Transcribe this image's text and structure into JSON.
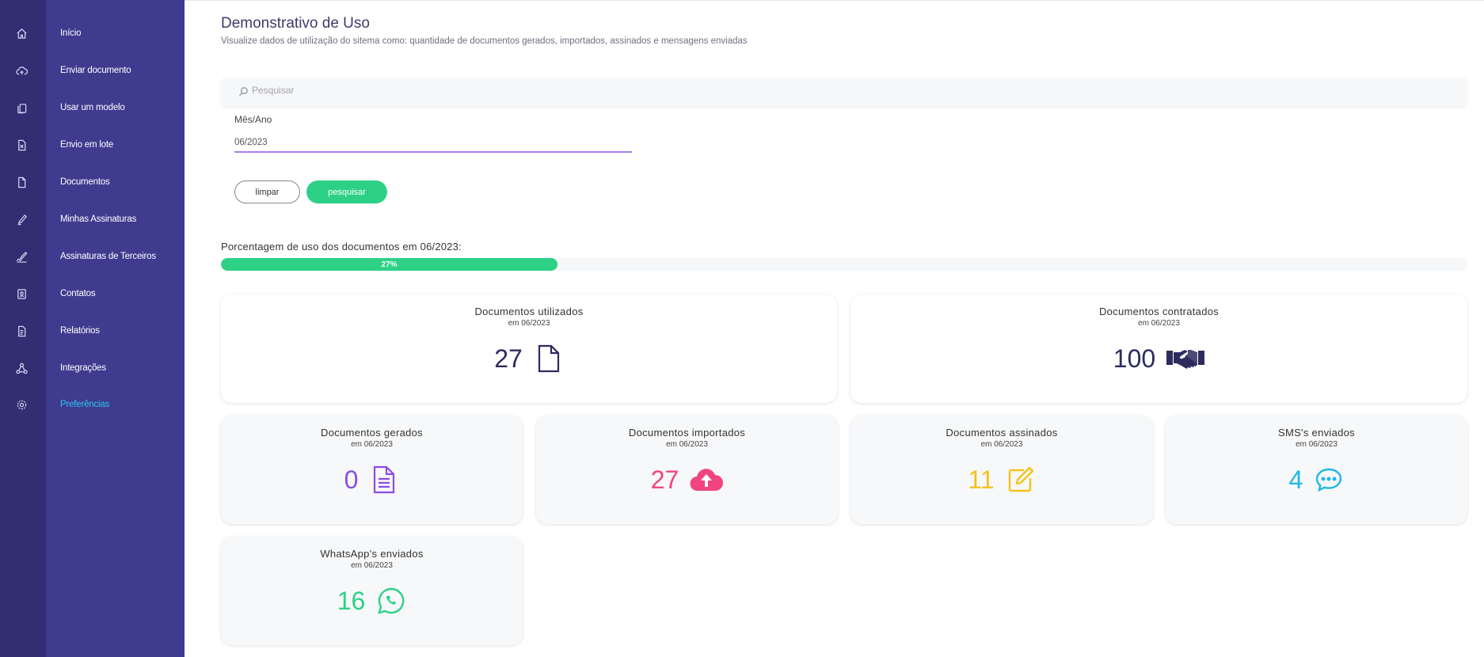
{
  "sidebar": {
    "items": [
      {
        "label": "Início",
        "icon": "home-icon"
      },
      {
        "label": "Enviar documento",
        "icon": "cloud-upload-icon"
      },
      {
        "label": "Usar um modelo",
        "icon": "template-icon"
      },
      {
        "label": "Envio em lote",
        "icon": "spreadsheet-icon"
      },
      {
        "label": "Documentos",
        "icon": "document-icon"
      },
      {
        "label": "Minhas Assinaturas",
        "icon": "pen-icon"
      },
      {
        "label": "Assinaturas de Terceiros",
        "icon": "signature-icon"
      },
      {
        "label": "Contatos",
        "icon": "contacts-icon"
      },
      {
        "label": "Relatórios",
        "icon": "report-icon"
      },
      {
        "label": "Integrações",
        "icon": "integrations-icon"
      },
      {
        "label": "Preferências",
        "icon": "gear-icon",
        "active": true
      }
    ]
  },
  "header": {
    "title": "Demonstrativo de Uso",
    "subtitle": "Visualize dados de utilização do sitema como: quantidade de documentos gerados, importados, assinados e mensagens enviadas"
  },
  "search": {
    "placeholder": "Pesquisar"
  },
  "filter": {
    "label": "Mês/Ano",
    "value": "06/2023",
    "clear_label": "limpar",
    "search_label": "pesquisar"
  },
  "usage": {
    "label": "Porcentagem de uso dos documentos em 06/2023:",
    "percent": 27,
    "percent_label": "27%"
  },
  "cards": {
    "utilizados": {
      "title": "Documentos utilizados",
      "sub": "em 06/2023",
      "value": "27",
      "color": "#2d2b5e",
      "icon": "file-icon"
    },
    "contratados": {
      "title": "Documentos contratados",
      "sub": "em 06/2023",
      "value": "100",
      "color": "#2d2b5e",
      "icon": "handshake-icon"
    },
    "gerados": {
      "title": "Documentos gerados",
      "sub": "em 06/2023",
      "value": "0",
      "color": "#8a4de6",
      "icon": "file-text-icon"
    },
    "importados": {
      "title": "Documentos importados",
      "sub": "em 06/2023",
      "value": "27",
      "color": "#f0457e",
      "icon": "cloud-upload-icon"
    },
    "assinados": {
      "title": "Documentos assinados",
      "sub": "em 06/2023",
      "value": "11",
      "color": "#f4c21c",
      "icon": "edit-icon"
    },
    "sms": {
      "title": "SMS's enviados",
      "sub": "em 06/2023",
      "value": "4",
      "color": "#1fb8e6",
      "icon": "chat-icon"
    },
    "whatsapp": {
      "title": "WhatsApp's enviados",
      "sub": "em 06/2023",
      "value": "16",
      "color": "#2dd186",
      "icon": "whatsapp-icon"
    }
  },
  "colors": {
    "rail": "#322e73",
    "nav": "#3f3b8f",
    "active": "#2ec4f0",
    "accent_green": "#2dd186",
    "input_underline": "#a77ff0"
  }
}
